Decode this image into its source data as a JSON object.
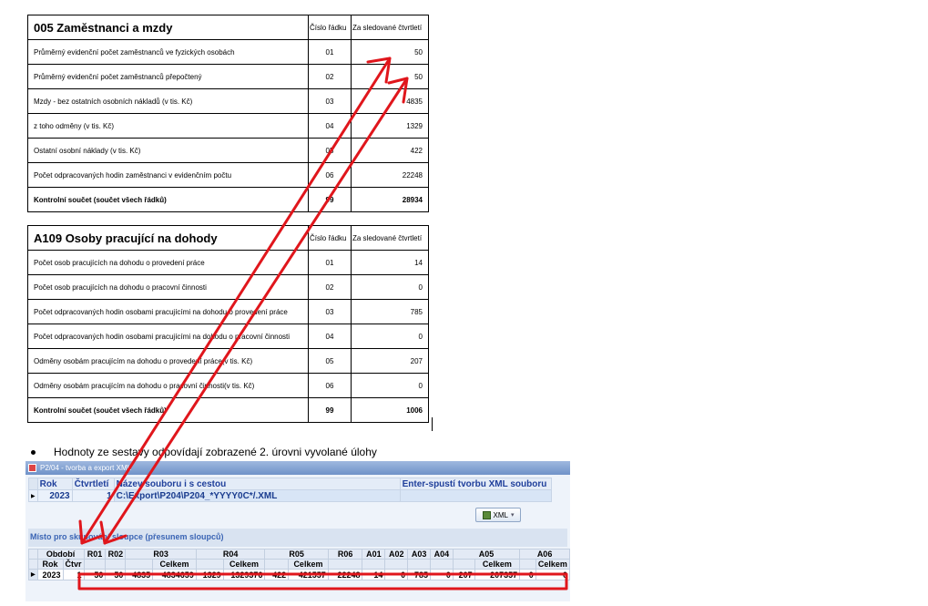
{
  "table1": {
    "title": "005 Zaměstnanci a mzdy",
    "col_code": "Číslo řádku",
    "col_value": "Za sledované čtvrtletí",
    "rows": [
      {
        "label": "Průměrný evidenční počet zaměstnanců ve fyzických osobách",
        "code": "01",
        "value": "50"
      },
      {
        "label": "Průměrný evidenční počet zaměstnanců přepočtený",
        "code": "02",
        "value": "50"
      },
      {
        "label": "Mzdy - bez ostatních osobních nákladů (v tis. Kč)",
        "code": "03",
        "value": "4835"
      },
      {
        "label": "z toho odměny (v tis. Kč)",
        "code": "04",
        "value": "1329"
      },
      {
        "label": "Ostatní osobní náklady (v tis. Kč)",
        "code": "05",
        "value": "422"
      },
      {
        "label": "Počet odpracovaných hodin zaměstnanci v evidenčním počtu",
        "code": "06",
        "value": "22248"
      }
    ],
    "total": {
      "label": "Kontrolní součet (součet všech řádků)",
      "code": "99",
      "value": "28934"
    }
  },
  "table2": {
    "title": "A109 Osoby pracující na dohody",
    "col_code": "Číslo řádku",
    "col_value": "Za sledované čtvrtletí",
    "rows": [
      {
        "label": "Počet osob pracujících na dohodu o provedení práce",
        "code": "01",
        "value": "14"
      },
      {
        "label": "Počet osob pracujících na dohodu o pracovní činnosti",
        "code": "02",
        "value": "0"
      },
      {
        "label": "Počet odpracovaných hodin osobami pracujícími na dohodu o provedení práce",
        "code": "03",
        "value": "785"
      },
      {
        "label": "Počet odpracovaných hodin osobami pracujícími na dohodu o pracovní činnosti",
        "code": "04",
        "value": "0"
      },
      {
        "label": "Odměny osobám pracujícím na dohodu o provedení práce(v tis. Kč)",
        "code": "05",
        "value": "207"
      },
      {
        "label": "Odměny osobám pracujícím na dohodu o pracovní činnosti(v tis. Kč)",
        "code": "06",
        "value": "0"
      }
    ],
    "total": {
      "label": "Kontrolní součet (součet všech řádků)",
      "code": "99",
      "value": "1006"
    }
  },
  "bullet_text": "Hodnoty ze sestavy odpovídají zobrazené 2. úrovni vyvolané úlohy",
  "app": {
    "title": "P2/04 - tvorba a export XML",
    "headers": {
      "rok": "Rok",
      "ctvrtleti": "Čtvrtletí",
      "nazev": "Název souboru i s cestou",
      "enter": "Enter-spustí tvorbu XML souboru"
    },
    "row": {
      "rok": "2023",
      "ctvrtleti": "1",
      "path": "C:\\Export\\P204\\P204_*YYYY0C*/.XML"
    },
    "xml_button": "XML",
    "group_label": "Místo pro skupování sloupce (přesunem sloupců)",
    "grid": {
      "top_headers": [
        "Období",
        "R01",
        "R02",
        "R03",
        "R04",
        "R05",
        "R06",
        "A01",
        "A02",
        "A03",
        "A04",
        "A05",
        "A06"
      ],
      "sub_rok": "Rok",
      "sub_ctvr": "Čtvr",
      "sub_celkem": "Celkem",
      "data": {
        "rok": "2023",
        "ctvr": "1",
        "r01": "50",
        "r02": "50",
        "r03": "4835",
        "r03c": "4834659",
        "r04": "1329",
        "r04c": "1329376",
        "r05": "422",
        "r05c": "421557",
        "r06": "22248",
        "a01": "14",
        "a02": "0",
        "a03": "785",
        "a04": "0",
        "a05": "207",
        "a05c": "207357",
        "a06": "0",
        "a06c": "0"
      }
    }
  },
  "colors": {
    "annotation_red": "#e0161c",
    "header_blue": "#1f3f9b"
  }
}
